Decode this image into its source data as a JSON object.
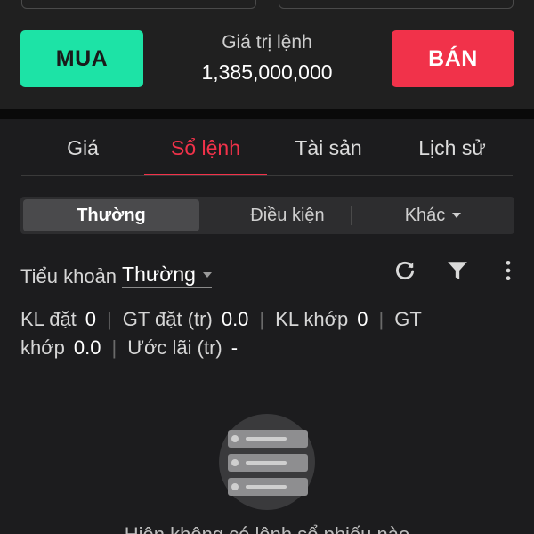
{
  "order": {
    "buy_label": "MUA",
    "sell_label": "BÁN",
    "value_label": "Giá trị lệnh",
    "value_amount": "1,385,000,000"
  },
  "main_tabs": [
    {
      "label": "Giá",
      "active": false
    },
    {
      "label": "Sổ lệnh",
      "active": true
    },
    {
      "label": "Tài sản",
      "active": false
    },
    {
      "label": "Lịch sử",
      "active": false
    }
  ],
  "segments": [
    {
      "label": "Thường",
      "active": true
    },
    {
      "label": "Điều kiện",
      "active": false
    },
    {
      "label": "Khác",
      "active": false
    }
  ],
  "sub_account": {
    "label": "Tiểu khoản",
    "value": "Thường"
  },
  "toolbar_icons": [
    "refresh-icon",
    "filter-icon",
    "more-vertical-icon"
  ],
  "stats": {
    "kl_dat_label": "KL đặt",
    "kl_dat_value": "0",
    "gt_dat_label": "GT đặt (tr)",
    "gt_dat_value": "0.0",
    "kl_khop_label": "KL khớp",
    "kl_khop_value": "0",
    "gt_khop_label": "GT khớp",
    "gt_khop_value": "0.0",
    "uoc_lai_label": "Ước lãi (tr)",
    "uoc_lai_value": "-"
  },
  "empty_state": {
    "message": "Hiện không có lệnh sổ phiếu nào"
  },
  "colors": {
    "buy": "#1de3a6",
    "sell": "#f1324a",
    "accent": "#f1324a",
    "background": "#1c1c1e"
  }
}
